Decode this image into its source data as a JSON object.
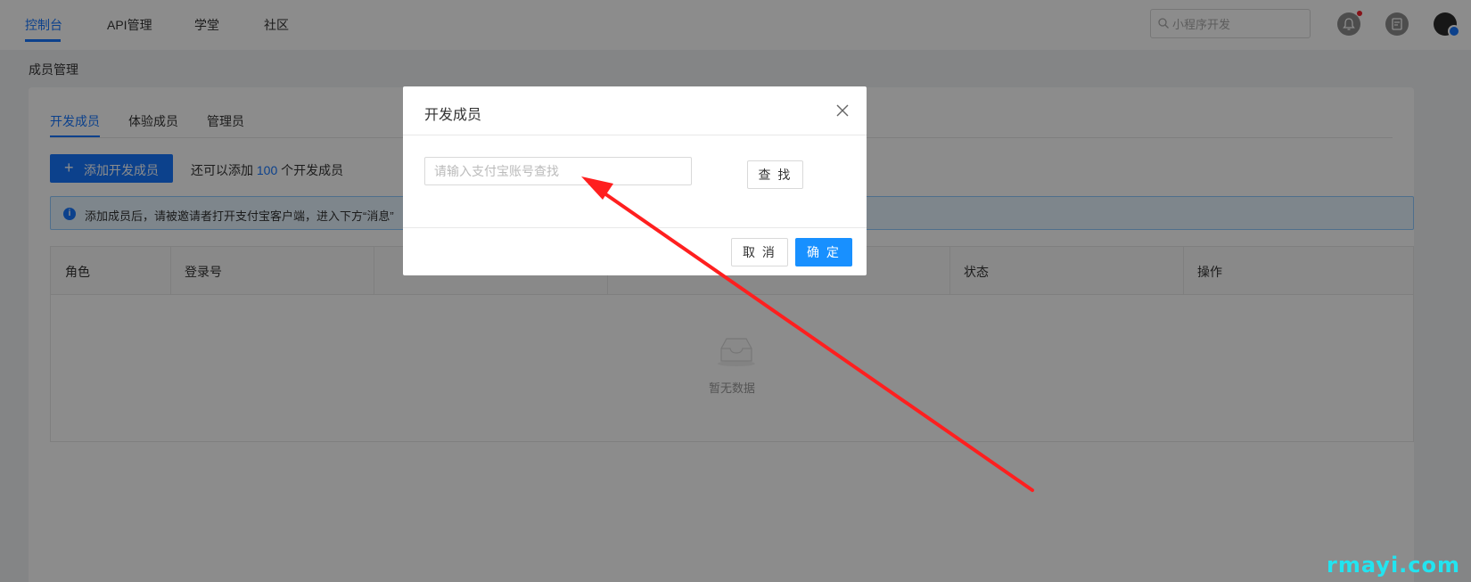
{
  "nav": {
    "items": [
      "控制台",
      "API管理",
      "学堂",
      "社区"
    ],
    "search_placeholder": "小程序开发"
  },
  "page": {
    "title": "成员管理",
    "tabs": [
      "开发成员",
      "体验成员",
      "管理员"
    ],
    "add_button": "添加开发成员",
    "quota_prefix": "还可以添加",
    "quota_count": "100",
    "quota_suffix": "个开发成员",
    "info_text": "添加成员后，请被邀请者打开支付宝客户端，进入下方“消息”",
    "table": {
      "columns": [
        "角色",
        "登录号",
        "",
        "",
        "状态",
        "操作"
      ],
      "empty_text": "暂无数据"
    }
  },
  "modal": {
    "title": "开发成员",
    "input_placeholder": "请输入支付宝账号查找",
    "find_button": "查 找",
    "cancel_button": "取 消",
    "ok_button": "确 定"
  },
  "watermark": "rmayi.com",
  "colors": {
    "accent": "#1677ff",
    "annotation_arrow": "#ff1f1f",
    "watermark": "#22e4f0"
  }
}
